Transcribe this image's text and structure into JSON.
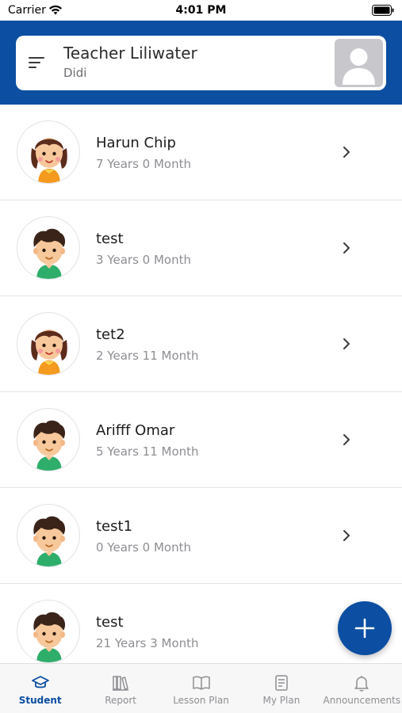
{
  "status_bar": {
    "carrier": "Carrier",
    "time": "4:01 PM"
  },
  "header": {
    "teacher_name": "Teacher Liliwater",
    "subtitle": "Didi",
    "accent_color": "#0b4ea2"
  },
  "students": [
    {
      "name": "Harun Chip",
      "age": "7 Years 0 Month",
      "avatar": "girl-avatar"
    },
    {
      "name": "test",
      "age": "3 Years 0 Month",
      "avatar": "boy-avatar"
    },
    {
      "name": "tet2",
      "age": "2 Years 11 Month",
      "avatar": "girl-avatar"
    },
    {
      "name": "Arifff Omar",
      "age": "5 Years 11 Month",
      "avatar": "boy-avatar"
    },
    {
      "name": "test1",
      "age": "0 Years 0 Month",
      "avatar": "boy-avatar"
    },
    {
      "name": "test",
      "age": "21 Years 3 Month",
      "avatar": "boy-avatar"
    }
  ],
  "fab": {
    "icon": "plus-icon"
  },
  "tabs": [
    {
      "label": "Student",
      "icon": "graduation-cap-icon",
      "active": true
    },
    {
      "label": "Report",
      "icon": "books-icon",
      "active": false
    },
    {
      "label": "Lesson Plan",
      "icon": "open-book-icon",
      "active": false
    },
    {
      "label": "My Plan",
      "icon": "document-icon",
      "active": false
    },
    {
      "label": "Announcements",
      "icon": "bell-icon",
      "active": false
    }
  ]
}
